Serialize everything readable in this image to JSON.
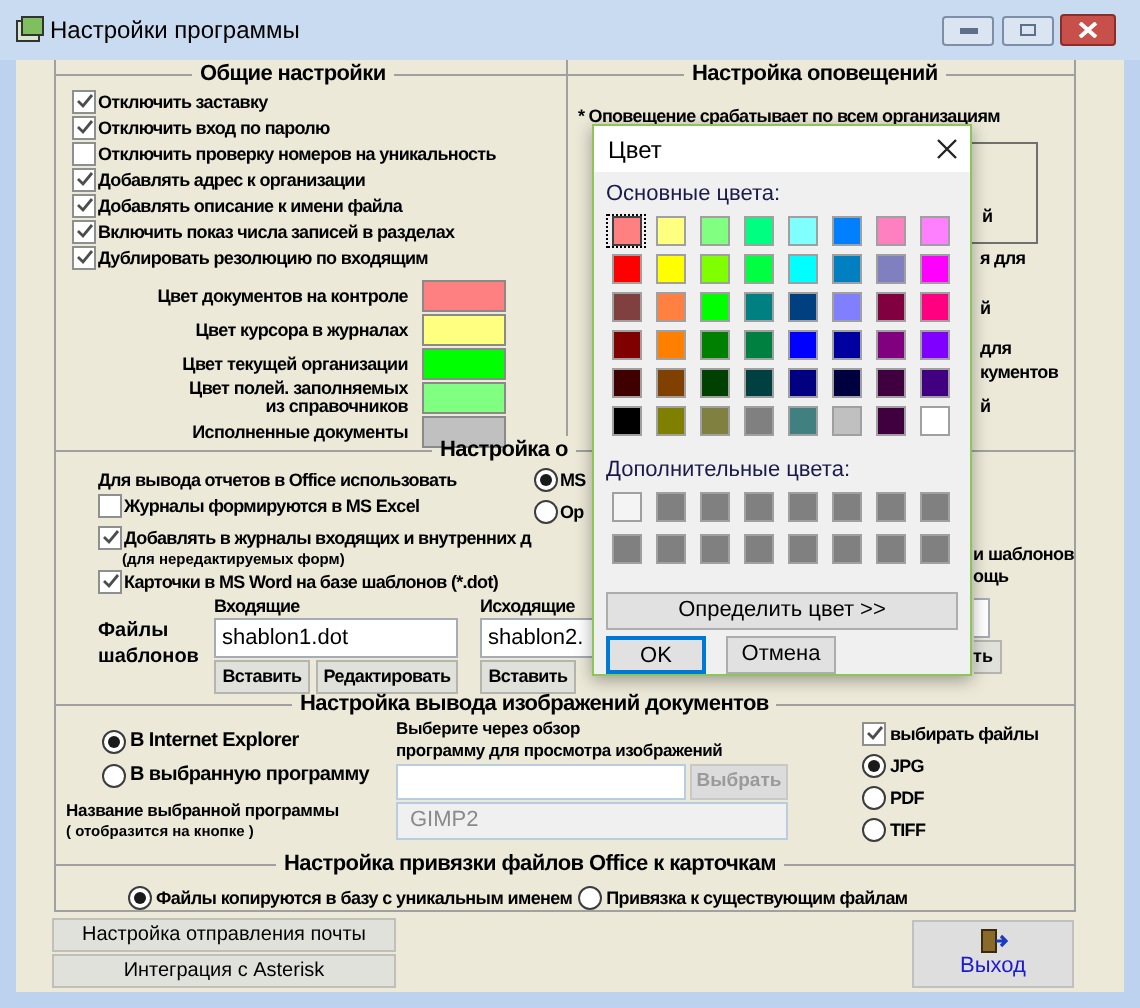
{
  "window": {
    "title": "Настройки программы"
  },
  "general": {
    "title": "Общие настройки",
    "options": [
      {
        "label": "Отключить заставку",
        "checked": true
      },
      {
        "label": "Отключить вход по паролю",
        "checked": true
      },
      {
        "label": "Отключить проверку номеров на уникальность",
        "checked": false
      },
      {
        "label": "Добавлять адрес к организации",
        "checked": true
      },
      {
        "label": "Добавлять описание к имени файла",
        "checked": true
      },
      {
        "label": "Включить показ числа записей в разделах",
        "checked": true
      },
      {
        "label": "Дублировать резолюцию по входящим",
        "checked": true
      }
    ],
    "colors": [
      {
        "label": "Цвет документов на контроле",
        "color": "#ff8080"
      },
      {
        "label": "Цвет курсора в журналах",
        "color": "#ffff80"
      },
      {
        "label": "Цвет текущей организации",
        "color": "#00ff00"
      },
      {
        "label": "Цвет полей. заполняемых\nиз справочников",
        "color": "#80ff80"
      },
      {
        "label": "Исполненные документы",
        "color": "#c0c0c0"
      }
    ]
  },
  "notifications": {
    "title": "Настройка оповещений",
    "note": "* Оповещение срабатывает по всем организациям",
    "frame_text": "й",
    "fragments": [
      "я для",
      "й",
      "для",
      "кументов",
      "й"
    ]
  },
  "office": {
    "title": "Настройка о",
    "prompt": "Для вывода отчетов в Office использовать",
    "formats": [
      {
        "label": "MS",
        "selected": true
      },
      {
        "label": "Ор",
        "selected": false
      }
    ],
    "options": [
      {
        "label": "Журналы формируются в MS Excel",
        "checked": false
      },
      {
        "label": "Добавлять в журналы входящих и внутренних д",
        "checked": true,
        "note": "(для нередактируемых форм)"
      },
      {
        "label": "Карточки в MS Word на базе шаблонов (*.dot)",
        "checked": true
      }
    ],
    "files_label": "Файлы\nшаблонов",
    "templates": [
      {
        "heading": "Входящие",
        "value": "shablon1.dot",
        "buttons": [
          "Вставить",
          "Редактировать"
        ]
      },
      {
        "heading": "Исходящие",
        "value": "shablon2.",
        "buttons": [
          "Вставить"
        ]
      }
    ],
    "side_fragments": [
      "и шаблонов",
      "ощь"
    ],
    "side_button": "ть"
  },
  "images": {
    "title": "Настройка вывода изображений документов",
    "targets": [
      {
        "label": "В Internet Explorer",
        "selected": true
      },
      {
        "label": "В выбранную программу",
        "selected": false
      }
    ],
    "browse_hint": "Выберите через обзор\nпрограмму для просмотра изображений",
    "browse_button": "Выбрать",
    "name_label": "Название выбранной программы",
    "name_hint": "( отобразится на кнопке )",
    "name_value": "GIMP2",
    "choose_files": {
      "label": "выбирать файлы",
      "checked": true
    },
    "formats": [
      {
        "label": "JPG",
        "selected": true
      },
      {
        "label": "PDF",
        "selected": false
      },
      {
        "label": "TIFF",
        "selected": false
      }
    ]
  },
  "binding": {
    "title": "Настройка привязки файлов Office к карточкам",
    "modes": [
      {
        "label": "Файлы копируются в базу с уникальным именем",
        "selected": true
      },
      {
        "label": "Привязка к существующим файлам",
        "selected": false
      }
    ]
  },
  "buttons": [
    "Настройка отправления почты",
    "Интеграция с Asterisk"
  ],
  "exit_button": "Выход",
  "color_dialog": {
    "title": "Цвет",
    "basic_label": "Основные цвета:",
    "basic_colors": [
      {
        "color": "#ff8080",
        "selected": true
      },
      {
        "color": "#ffff80",
        "selected": false
      },
      {
        "color": "#80ff80",
        "selected": false
      },
      {
        "color": "#00ff80",
        "selected": false
      },
      {
        "color": "#80ffff",
        "selected": false
      },
      {
        "color": "#0080ff",
        "selected": false
      },
      {
        "color": "#ff80c0",
        "selected": false
      },
      {
        "color": "#ff80ff",
        "selected": false
      },
      {
        "color": "#ff0000",
        "selected": false
      },
      {
        "color": "#ffff00",
        "selected": false
      },
      {
        "color": "#80ff00",
        "selected": false
      },
      {
        "color": "#00ff40",
        "selected": false
      },
      {
        "color": "#00ffff",
        "selected": false
      },
      {
        "color": "#0080c0",
        "selected": false
      },
      {
        "color": "#8080c0",
        "selected": false
      },
      {
        "color": "#ff00ff",
        "selected": false
      },
      {
        "color": "#804040",
        "selected": false
      },
      {
        "color": "#ff8040",
        "selected": false
      },
      {
        "color": "#00ff00",
        "selected": false
      },
      {
        "color": "#008080",
        "selected": false
      },
      {
        "color": "#004080",
        "selected": false
      },
      {
        "color": "#8080ff",
        "selected": false
      },
      {
        "color": "#800040",
        "selected": false
      },
      {
        "color": "#ff0080",
        "selected": false
      },
      {
        "color": "#800000",
        "selected": false
      },
      {
        "color": "#ff8000",
        "selected": false
      },
      {
        "color": "#008000",
        "selected": false
      },
      {
        "color": "#008040",
        "selected": false
      },
      {
        "color": "#0000ff",
        "selected": false
      },
      {
        "color": "#0000a0",
        "selected": false
      },
      {
        "color": "#800080",
        "selected": false
      },
      {
        "color": "#8000ff",
        "selected": false
      },
      {
        "color": "#400000",
        "selected": false
      },
      {
        "color": "#804000",
        "selected": false
      },
      {
        "color": "#004000",
        "selected": false
      },
      {
        "color": "#004040",
        "selected": false
      },
      {
        "color": "#000080",
        "selected": false
      },
      {
        "color": "#000040",
        "selected": false
      },
      {
        "color": "#400040",
        "selected": false
      },
      {
        "color": "#400080",
        "selected": false
      },
      {
        "color": "#000000",
        "selected": false
      },
      {
        "color": "#808000",
        "selected": false
      },
      {
        "color": "#808040",
        "selected": false
      },
      {
        "color": "#808080",
        "selected": false
      },
      {
        "color": "#408080",
        "selected": false
      },
      {
        "color": "#c0c0c0",
        "selected": false
      },
      {
        "color": "#400040",
        "selected": false
      },
      {
        "color": "#ffffff",
        "selected": false
      }
    ],
    "custom_label": "Дополнительные цвета:",
    "custom_colors": [
      {
        "color": "#f4f4f4"
      },
      {
        "color": "#808080"
      },
      {
        "color": "#808080"
      },
      {
        "color": "#808080"
      },
      {
        "color": "#808080"
      },
      {
        "color": "#808080"
      },
      {
        "color": "#808080"
      },
      {
        "color": "#808080"
      },
      {
        "color": "#808080"
      },
      {
        "color": "#808080"
      },
      {
        "color": "#808080"
      },
      {
        "color": "#808080"
      },
      {
        "color": "#808080"
      },
      {
        "color": "#808080"
      },
      {
        "color": "#808080"
      },
      {
        "color": "#808080"
      }
    ],
    "define_button": "Определить цвет >>",
    "ok_button": "OK",
    "cancel_button": "Отмена"
  }
}
